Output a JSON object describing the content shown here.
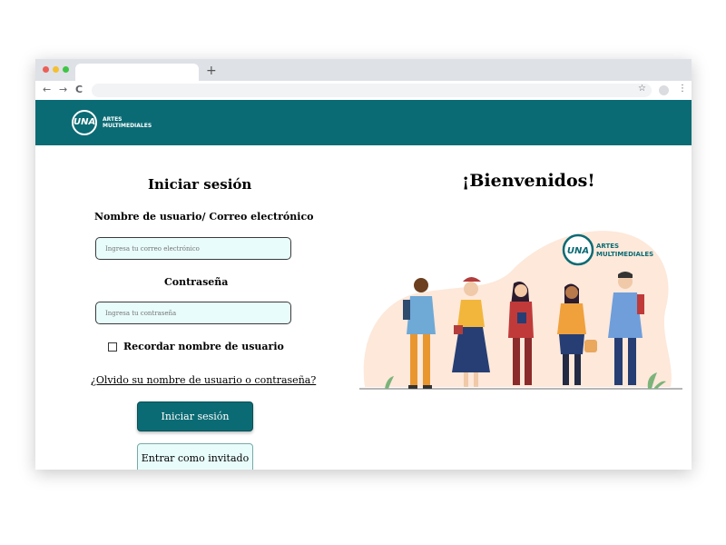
{
  "browser": {
    "new_tab_symbol": "+",
    "back": "←",
    "forward": "→",
    "reload": "C",
    "star": "☆",
    "menu": "⋮"
  },
  "brand": {
    "logo_text": "UNA",
    "name_line1": "ARTES",
    "name_line2": "MULTIMEDIALES",
    "color": "#0b6b74"
  },
  "login": {
    "title": "Iniciar sesión",
    "user_label": "Nombre de usuario/ Correo electrónico",
    "user_placeholder": "Ingresa tu correo electrónico",
    "password_label": "Contraseña",
    "password_placeholder": "Ingresa tu contraseña",
    "remember_label": "Recordar nombre de usuario",
    "forgot_link": "¿Olvido su nombre de usuario o contraseña?",
    "login_button": "Iniciar sesión",
    "guest_button": "Entrar como invitado"
  },
  "welcome": {
    "title": "¡Bienvenidos!"
  },
  "illustration": {
    "logo_text": "UNA",
    "line1": "ARTES",
    "line2": "MULTIMEDIALES"
  }
}
